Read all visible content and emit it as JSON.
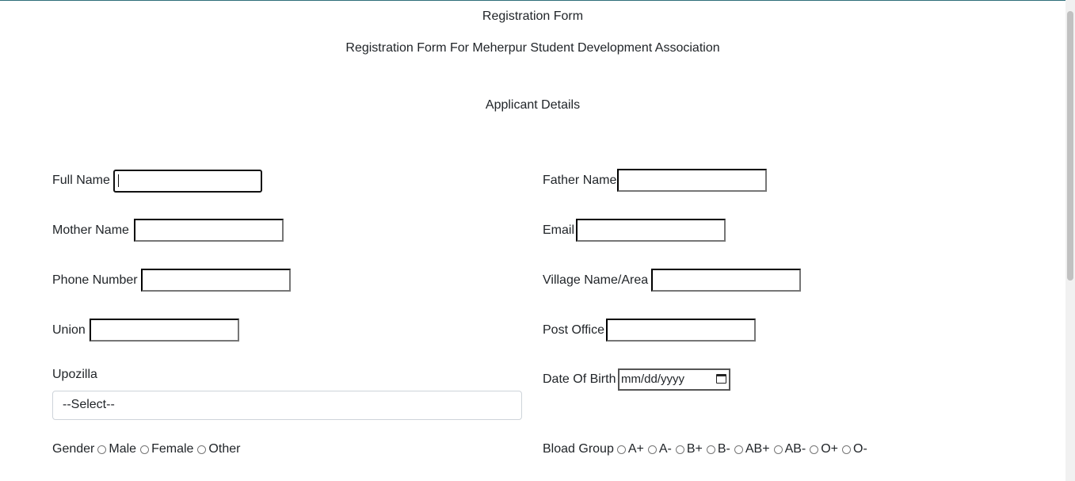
{
  "header": {
    "title": "Registration Form",
    "subtitle": "Registration Form For Meherpur Student Development Association",
    "section": "Applicant Details"
  },
  "fields": {
    "full_name": {
      "label": "Full Name",
      "value": ""
    },
    "father_name": {
      "label": "Father Name",
      "value": ""
    },
    "mother_name": {
      "label": "Mother Name",
      "value": ""
    },
    "email": {
      "label": "Email",
      "value": ""
    },
    "phone": {
      "label": "Phone Number",
      "value": ""
    },
    "village": {
      "label": "Village Name/Area",
      "value": ""
    },
    "union": {
      "label": "Union",
      "value": ""
    },
    "post_office": {
      "label": "Post Office",
      "value": ""
    },
    "upozilla": {
      "label": "Upozilla",
      "selected": "--Select--"
    },
    "dob": {
      "label": "Date Of Birth",
      "placeholder": "mm/dd/yyyy"
    }
  },
  "gender": {
    "label": "Gender",
    "options": [
      "Male",
      "Female",
      "Other"
    ]
  },
  "blood_group": {
    "label": "Bload Group",
    "options": [
      "A+",
      "A-",
      "B+",
      "B-",
      "AB+",
      "AB-",
      "O+",
      "O-"
    ]
  }
}
